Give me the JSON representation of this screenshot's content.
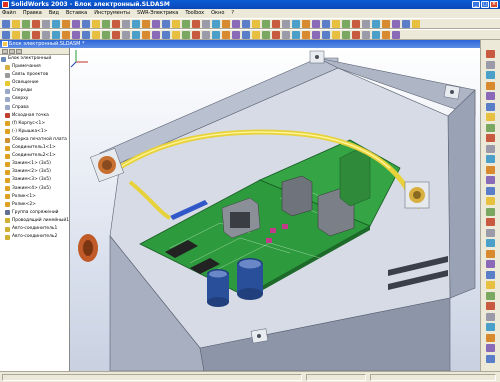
{
  "window": {
    "title": "SolidWorks 2003 - Блок электронный.SLDASM"
  },
  "menu": [
    "Файл",
    "Правка",
    "Вид",
    "Вставка",
    "Инструменты",
    "SWR-Электрика",
    "Toolbox",
    "Окно",
    "?"
  ],
  "document": {
    "title": "Блок электронный.SLDASM *"
  },
  "tree": {
    "items": [
      {
        "label": "Блок электронный",
        "level": 0,
        "icon": "assembly-icon",
        "color": "#6a8ab8"
      },
      {
        "label": "Примечания",
        "level": 1,
        "icon": "annotations-icon",
        "color": "#d8b040"
      },
      {
        "label": "Связь проектов",
        "level": 1,
        "icon": "design-binder-icon",
        "color": "#9a9a9a"
      },
      {
        "label": "Освещение",
        "level": 1,
        "icon": "lighting-icon",
        "color": "#e8c830"
      },
      {
        "label": "Спереди",
        "level": 1,
        "icon": "plane-icon",
        "color": "#9aa8c8"
      },
      {
        "label": "Сверху",
        "level": 1,
        "icon": "plane-icon",
        "color": "#9aa8c8"
      },
      {
        "label": "Справа",
        "level": 1,
        "icon": "plane-icon",
        "color": "#9aa8c8"
      },
      {
        "label": "Исходная точка",
        "level": 1,
        "icon": "origin-icon",
        "color": "#c04030"
      },
      {
        "label": "(f) Корпус<1>",
        "level": 1,
        "icon": "part-icon",
        "color": "#e0a020"
      },
      {
        "label": "(-) Крышка<1>",
        "level": 1,
        "icon": "part-icon",
        "color": "#e0a020"
      },
      {
        "label": "Сборка печатной плата",
        "level": 1,
        "icon": "subassembly-icon",
        "color": "#d09030"
      },
      {
        "label": "Соединитель1<1>",
        "level": 1,
        "icon": "part-icon",
        "color": "#e0a020"
      },
      {
        "label": "Соединитель2<1>",
        "level": 1,
        "icon": "part-icon",
        "color": "#e0a020"
      },
      {
        "label": "Зажим<1> (3x5)",
        "level": 1,
        "icon": "part-icon",
        "color": "#e0a020"
      },
      {
        "label": "Зажим<2> (3x5)",
        "level": 1,
        "icon": "part-icon",
        "color": "#e0a020"
      },
      {
        "label": "Зажим<3> (3x5)",
        "level": 1,
        "icon": "part-icon",
        "color": "#e0a020"
      },
      {
        "label": "Зажим<4> (3x5)",
        "level": 1,
        "icon": "part-icon",
        "color": "#e0a020"
      },
      {
        "label": "Ролик<1>",
        "level": 1,
        "icon": "part-icon",
        "color": "#e0a020"
      },
      {
        "label": "Ролик<2>",
        "level": 1,
        "icon": "part-icon",
        "color": "#e0a020"
      },
      {
        "label": "Группа сопряжений",
        "level": 1,
        "icon": "mates-icon",
        "color": "#607090"
      },
      {
        "label": "Проводящий линейный1",
        "level": 1,
        "icon": "route-icon",
        "color": "#d0b030"
      },
      {
        "label": "Авто-соединитель1",
        "level": 1,
        "icon": "route-icon",
        "color": "#d0b030"
      },
      {
        "label": "Авто-соединитель2",
        "level": 1,
        "icon": "route-icon",
        "color": "#d0b030"
      }
    ]
  },
  "colors": {
    "pcb": "#2e9a3e",
    "enclosure": "#bfc6d4",
    "cable": "#e8d23c",
    "capacitor": "#2a4f9a",
    "connector": "#c87030"
  }
}
